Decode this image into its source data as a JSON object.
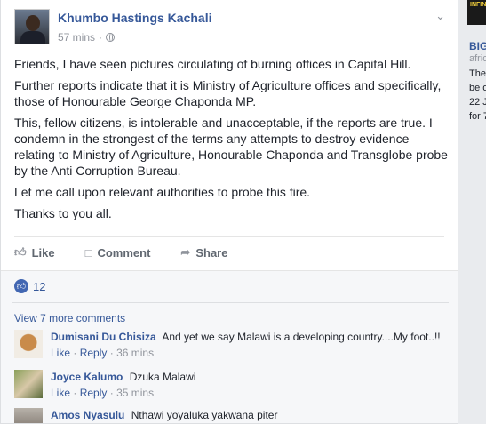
{
  "post": {
    "author": "Khumbo Hastings Kachali",
    "time": "57 mins",
    "dot": "·",
    "paragraphs": [
      "Friends, I have seen pictures circulating of burning offices in Capital Hill.",
      "Further reports indicate that it is Ministry of Agriculture offices and specifically, those of Honourable George Chaponda MP.",
      "This, fellow citizens, is intolerable and unacceptable, if the reports are true. I condemn in the strongest of the terms any attempts to destroy evidence relating to Ministry of Agriculture, Honourable Chaponda and Transglobe probe by the Anti Corruption Bureau.",
      "Let me call upon relevant authorities to probe this fire.",
      "Thanks to you all."
    ],
    "actions": {
      "like": "Like",
      "comment": "Comment",
      "share": "Share"
    },
    "reaction_count": "12"
  },
  "comments": {
    "view_more": "View 7 more comments",
    "items": [
      {
        "name": "Dumisani Du Chisiza",
        "text": "And yet we say Malawi is a developing country....My foot..!!",
        "like": "Like",
        "reply": "Reply",
        "time": "36 mins"
      },
      {
        "name": "Joyce Kalumo",
        "text": "Dzuka Malawi",
        "like": "Like",
        "reply": "Reply",
        "time": "35 mins"
      },
      {
        "name": "Amos Nyasulu",
        "text": "Nthawi yoyaluka yakwana piter"
      }
    ],
    "dot": "·"
  },
  "sidebar": {
    "thumb_text": "INFIN",
    "big": "BIG",
    "lines": [
      "afric",
      "The",
      "be o",
      "22 J",
      "for 7"
    ]
  }
}
